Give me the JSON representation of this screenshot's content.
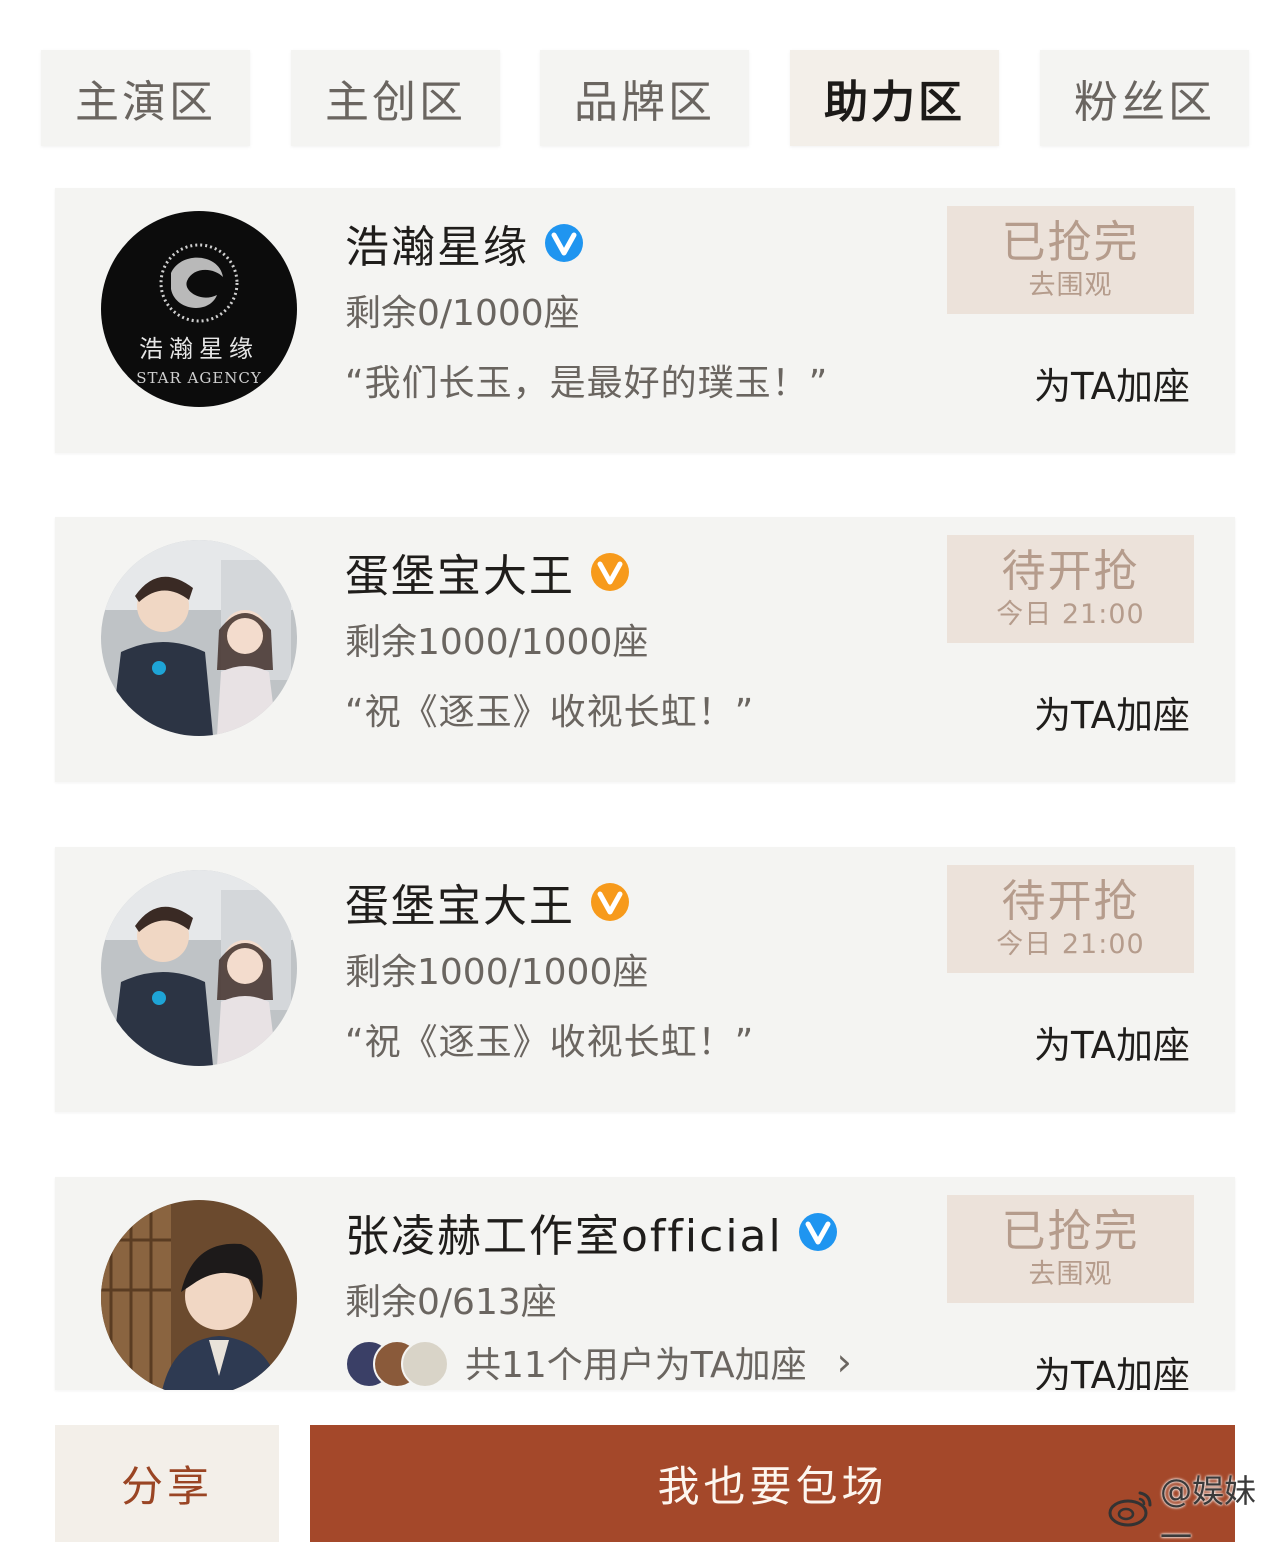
{
  "tabs": [
    {
      "label": "主演区",
      "active": false
    },
    {
      "label": "主创区",
      "active": false
    },
    {
      "label": "品牌区",
      "active": false
    },
    {
      "label": "助力区",
      "active": true
    },
    {
      "label": "粉丝区",
      "active": false
    }
  ],
  "cards": [
    {
      "name": "浩瀚星缘",
      "verified_color": "#1f95f0",
      "avatar_caption": "浩瀚星缘",
      "avatar_caption_en": "STAR AGENCY",
      "seats": "剩余0/1000座",
      "quote": "“我们长玉，是最好的璞玉！”",
      "status_main": "已抢完",
      "status_sub": "去围观",
      "action": "为TA加座"
    },
    {
      "name": "蛋堡宝大王",
      "verified_color": "#f79a1b",
      "seats": "剩余1000/1000座",
      "quote": "“祝《逐玉》收视长虹！”",
      "status_main": "待开抢",
      "status_sub": "今日 21:00",
      "action": "为TA加座"
    },
    {
      "name": "蛋堡宝大王",
      "verified_color": "#f79a1b",
      "seats": "剩余1000/1000座",
      "quote": "“祝《逐玉》收视长虹！”",
      "status_main": "待开抢",
      "status_sub": "今日 21:00",
      "action": "为TA加座"
    },
    {
      "name": "张凌赫工作室official",
      "verified_color": "#1f95f0",
      "seats": "剩余0/613座",
      "supporters_text": "共11个用户为TA加座",
      "status_main": "已抢完",
      "status_sub": "去围观",
      "action": "为TA加座"
    }
  ],
  "bottom": {
    "share_label": "分享",
    "book_label": "我也要包场"
  },
  "watermark": "@娱妹一",
  "colors": {
    "accent": "#a4482a",
    "status_bg": "#ece2da",
    "status_text": "#b59c8c"
  }
}
